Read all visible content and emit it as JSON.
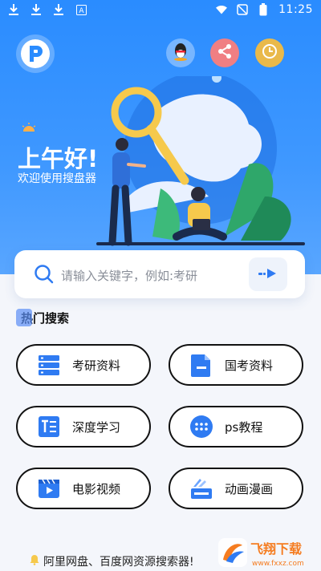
{
  "status_bar": {
    "time": "11:25",
    "icons": [
      "download-icon",
      "download-icon",
      "download-icon",
      "a-icon",
      "wifi-icon",
      "sim-off-icon",
      "battery-icon"
    ]
  },
  "header": {
    "logo": "p-logo-icon",
    "buttons": [
      "qq-icon",
      "share-icon",
      "history-icon"
    ]
  },
  "greeting": {
    "title": "上午好!",
    "subtitle": "欢迎使用搜盘器"
  },
  "search": {
    "placeholder": "请输入关键字，例如:考研",
    "go_icon": "send-icon"
  },
  "hot": {
    "title": "热门搜索",
    "items": [
      {
        "label": "考研资料",
        "icon": "list-icon"
      },
      {
        "label": "国考资料",
        "icon": "document-icon"
      },
      {
        "label": "深度学习",
        "icon": "text-icon"
      },
      {
        "label": "ps教程",
        "icon": "grid-icon"
      },
      {
        "label": "电影视频",
        "icon": "video-icon"
      },
      {
        "label": "动画漫画",
        "icon": "animation-icon"
      }
    ]
  },
  "footer": {
    "text": "阿里网盘、百度网资源搜索器!"
  },
  "watermark": {
    "text": "飞翔下载",
    "sub": "www.fxxz.com"
  },
  "colors": {
    "primary": "#2a8cff",
    "icon_blue": "#2f7bf2"
  }
}
